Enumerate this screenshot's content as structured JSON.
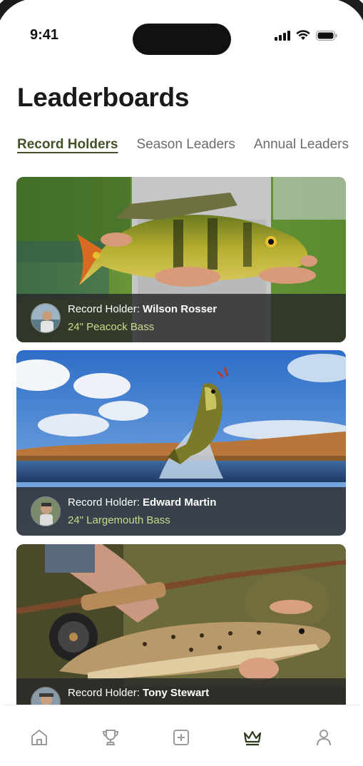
{
  "status_bar": {
    "time": "9:41"
  },
  "page": {
    "title": "Leaderboards"
  },
  "tabs": [
    {
      "label": "Record Holders",
      "active": true
    },
    {
      "label": "Season Leaders",
      "active": false
    },
    {
      "label": "Annual Leaders",
      "active": false
    }
  ],
  "records": [
    {
      "prefix": "Record Holder: ",
      "holder": "Wilson Rosser",
      "fish": "24\" Peacock Bass",
      "photo": "peacock-bass-photo"
    },
    {
      "prefix": "Record Holder: ",
      "holder": "Edward Martin",
      "fish": "24\" Largemouth Bass",
      "photo": "largemouth-bass-photo"
    },
    {
      "prefix": "Record Holder: ",
      "holder": "Tony Stewart",
      "fish": "",
      "photo": "brown-trout-photo"
    }
  ],
  "nav": [
    {
      "icon": "home-icon",
      "active": false
    },
    {
      "icon": "trophy-icon",
      "active": false
    },
    {
      "icon": "add-icon",
      "active": false
    },
    {
      "icon": "crown-icon",
      "active": true
    },
    {
      "icon": "profile-icon",
      "active": false
    }
  ],
  "colors": {
    "accent": "#44522a",
    "fish_text": "#c9dc8a",
    "nav_active": "#2e3a1f",
    "nav_inactive": "#9a9a9a"
  }
}
